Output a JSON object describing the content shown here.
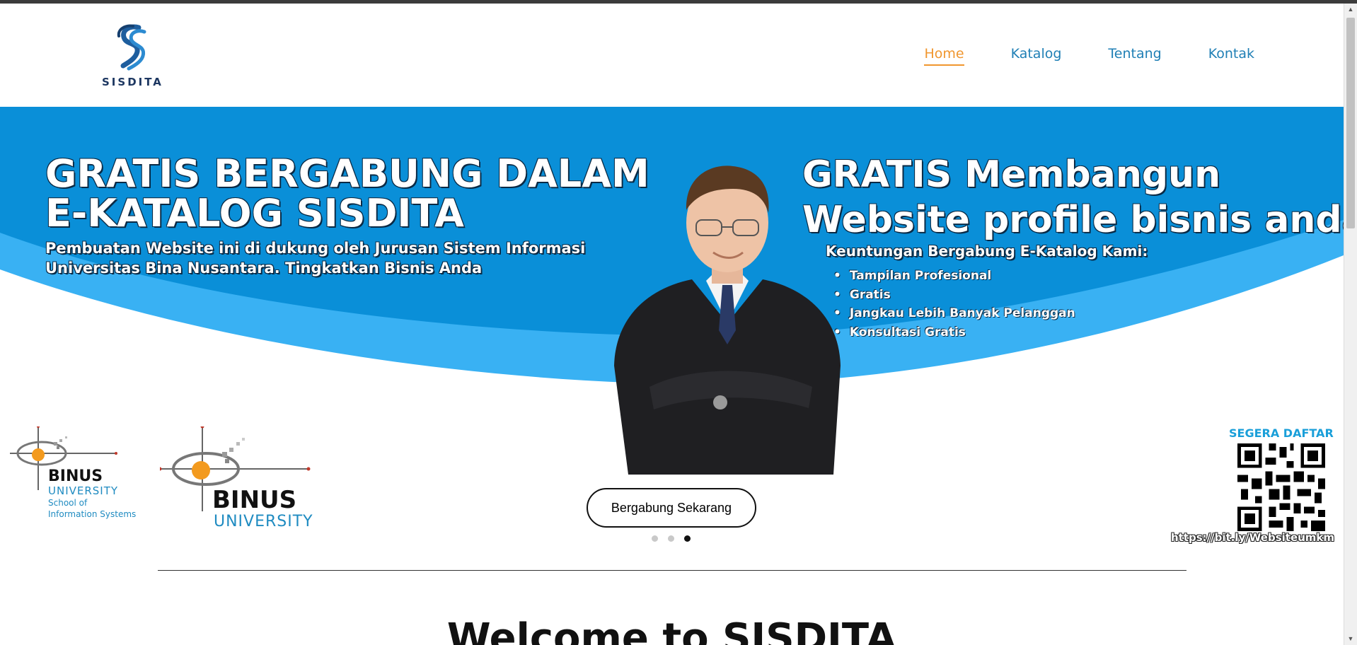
{
  "logo": {
    "wordmark": "SISDITA",
    "icon": "sisdita-s-logo-icon"
  },
  "nav": {
    "items": [
      {
        "label": "Home",
        "active": true
      },
      {
        "label": "Katalog",
        "active": false
      },
      {
        "label": "Tentang",
        "active": false
      },
      {
        "label": "Kontak",
        "active": false
      }
    ]
  },
  "hero": {
    "left_title_line1": "GRATIS BERGABUNG DALAM",
    "left_title_line2": "E-KATALOG SISDITA",
    "left_subtitle_line1": "Pembuatan Website ini di dukung oleh Jurusan Sistem Informasi",
    "left_subtitle_line2": "Universitas Bina Nusantara. Tingkatkan Bisnis Anda",
    "right_title_line1": "GRATIS Membangun",
    "right_title_line2": "Website profile bisnis anda",
    "benefits_title": "Keuntungan Bergabung E-Katalog Kami:",
    "benefits": [
      "Tampilan Profesional",
      "Gratis",
      "Jangkau Lebih Banyak Pelanggan",
      "Konsultasi Gratis"
    ],
    "binus_small": {
      "name": "BINUS",
      "sub": "UNIVERSITY",
      "school_line1": "School of",
      "school_line2": "Information Systems"
    },
    "binus_large": {
      "name": "BINUS",
      "sub": "UNIVERSITY"
    },
    "qr_title": "SEGERA DAFTAR",
    "qr_url": "https://bit.ly/Websiteumkm",
    "prev_arrow": "‹",
    "next_arrow": "›",
    "cta_label": "Bergabung Sekarang",
    "slides": {
      "count": 3,
      "active_index": 2
    }
  },
  "colors": {
    "hero_blue": "#0a8fd8",
    "hero_light_blue": "#39b1f3",
    "nav_link": "#1f7fb5",
    "nav_active": "#f0962e"
  },
  "welcome": {
    "heading": "Welcome to SISDITA"
  }
}
